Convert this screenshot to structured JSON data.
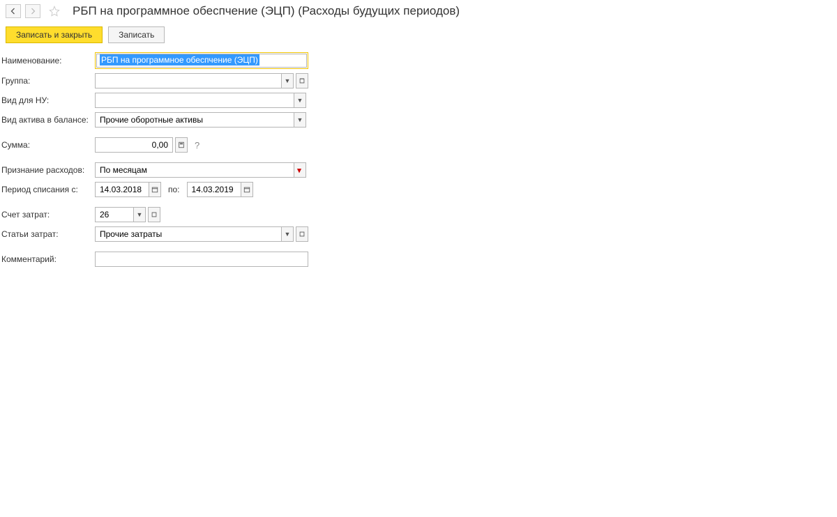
{
  "header": {
    "title": "РБП на программное обеспчение (ЭЦП) (Расходы будущих периодов)"
  },
  "toolbar": {
    "save_close": "Записать и закрыть",
    "save": "Записать"
  },
  "form": {
    "name_label": "Наименование:",
    "name_value": "РБП на программное обеспчение (ЭЦП)",
    "group_label": "Группа:",
    "group_value": "",
    "nu_type_label": "Вид для НУ:",
    "nu_type_value": "",
    "balance_asset_label": "Вид актива в балансе:",
    "balance_asset_value": "Прочие оборотные активы",
    "sum_label": "Сумма:",
    "sum_value": "0,00",
    "expense_recognition_label": "Признание расходов:",
    "expense_recognition_value": "По месяцам",
    "writeoff_period_label": "Период списания с:",
    "writeoff_from": "14.03.2018",
    "writeoff_to_label": "по:",
    "writeoff_to": "14.03.2019",
    "cost_account_label": "Счет затрат:",
    "cost_account_value": "26",
    "cost_items_label": "Статьи затрат:",
    "cost_items_value": "Прочие затраты",
    "comment_label": "Комментарий:",
    "comment_value": ""
  },
  "icons": {
    "help": "?"
  }
}
